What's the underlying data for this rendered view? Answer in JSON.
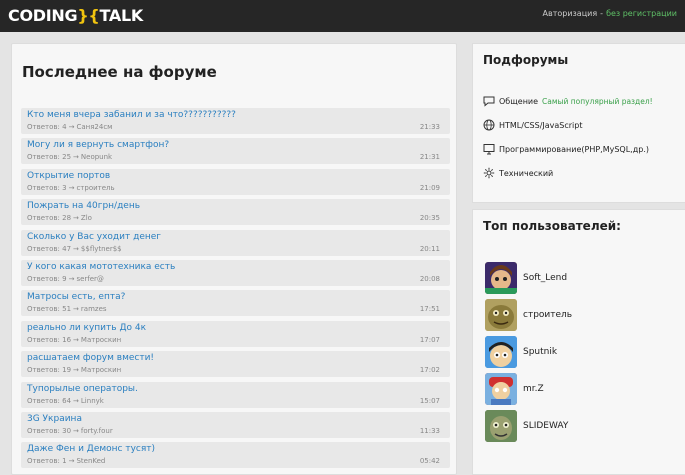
{
  "header": {
    "logo_left": "CODING",
    "logo_brace": "}{",
    "logo_right": "TALK",
    "auth_login": "Авторизация",
    "auth_sep": "-",
    "auth_register": "без регистрации"
  },
  "main": {
    "title": "Последнее на форуме",
    "topics": [
      {
        "title": "Кто меня вчера забанил и за что???????????",
        "replies_label": "Ответов:",
        "replies": "4",
        "author": "Саня24см",
        "time": "21:33"
      },
      {
        "title": "Могу ли я вернуть смартфон?",
        "replies_label": "Ответов:",
        "replies": "25",
        "author": "Neopunk",
        "time": "21:31"
      },
      {
        "title": "Открытие портов",
        "replies_label": "Ответов:",
        "replies": "3",
        "author": "строитель",
        "time": "21:09"
      },
      {
        "title": "Пожрать на 40грн/день",
        "replies_label": "Ответов:",
        "replies": "28",
        "author": "Zlo",
        "time": "20:35"
      },
      {
        "title": "Сколько у Вас уходит денег",
        "replies_label": "Ответов:",
        "replies": "47",
        "author": "$$flytner$$",
        "time": "20:11"
      },
      {
        "title": "У кого какая мототехника есть",
        "replies_label": "Ответов:",
        "replies": "9",
        "author": "serfer@",
        "time": "20:08"
      },
      {
        "title": "Матросы есть, епта?",
        "replies_label": "Ответов:",
        "replies": "51",
        "author": "ramzes",
        "time": "17:51"
      },
      {
        "title": "реально ли купить До 4к",
        "replies_label": "Ответов:",
        "replies": "16",
        "author": "Матроскин",
        "time": "17:07"
      },
      {
        "title": "расшатаем форум вмести!",
        "replies_label": "Ответов:",
        "replies": "19",
        "author": "Матроскин",
        "time": "17:02"
      },
      {
        "title": "Тупорылые операторы.",
        "replies_label": "Ответов:",
        "replies": "64",
        "author": "Linnyk",
        "time": "15:07"
      },
      {
        "title": "3G Украина",
        "replies_label": "Ответов:",
        "replies": "30",
        "author": "forty.four",
        "time": "11:33"
      },
      {
        "title": "Даже Фен и Демонс тусят)",
        "replies_label": "Ответов:",
        "replies": "1",
        "author": "StenKed",
        "time": "05:42"
      }
    ]
  },
  "subforums": {
    "title": "Подфорумы",
    "items": [
      {
        "label": "Общение",
        "desc": "Самый популярный раздел!",
        "icon": "speech-bubble-icon"
      },
      {
        "label": "HTML/CSS/JavaScript",
        "desc": "",
        "icon": "globe-icon"
      },
      {
        "label": "Программирование(PHP,MySQL,др.)",
        "desc": "",
        "icon": "monitor-icon"
      },
      {
        "label": "Технический",
        "desc": "",
        "icon": "gear-icon"
      }
    ]
  },
  "top_users": {
    "title": "Топ пользователей:",
    "users": [
      {
        "name": "Soft_Lend",
        "avatar_color": "#7a4a2a"
      },
      {
        "name": "строитель",
        "avatar_color": "#8a7a3a"
      },
      {
        "name": "Sputnik",
        "avatar_color": "#3a8ad0"
      },
      {
        "name": "mr.Z",
        "avatar_color": "#c04040"
      },
      {
        "name": "SLIDEWAY",
        "avatar_color": "#5a7a4a"
      }
    ]
  },
  "colors": {
    "link": "#2a7fc0",
    "accent_green": "#3aa04a",
    "topbar": "#262626"
  }
}
